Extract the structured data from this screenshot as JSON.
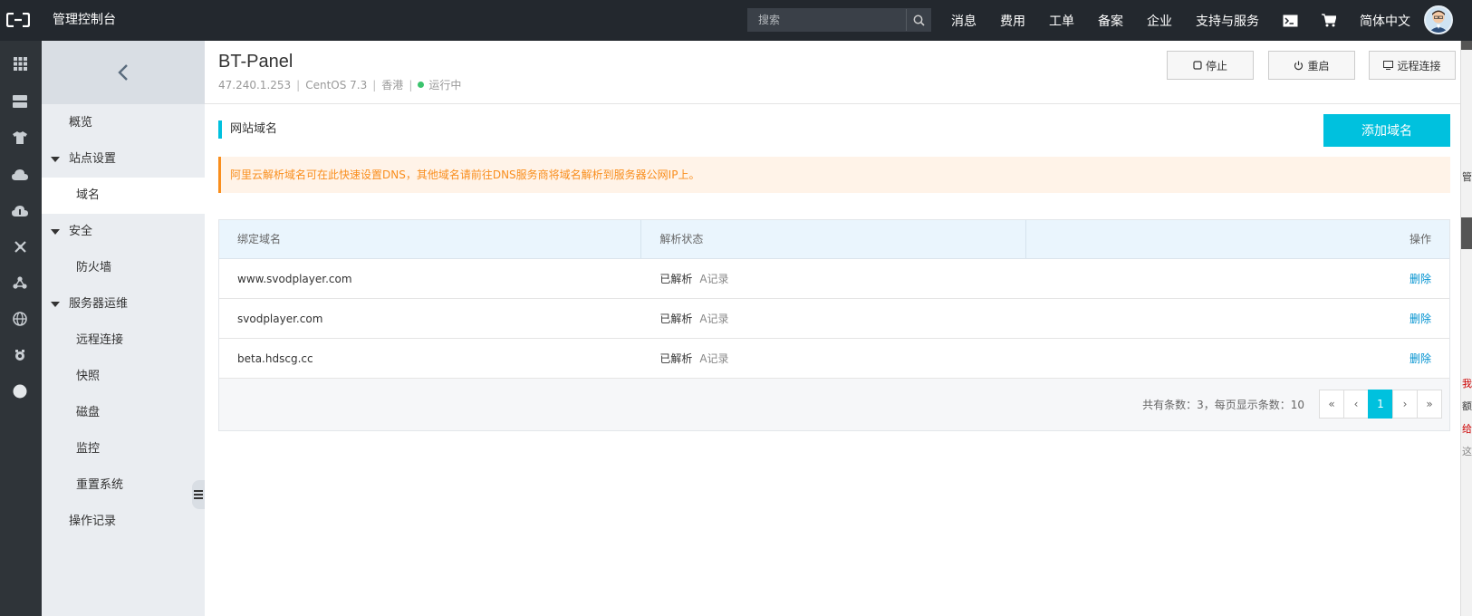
{
  "topbar": {
    "title": "管理控制台",
    "search_placeholder": "搜索",
    "nav": [
      "消息",
      "费用",
      "工单",
      "备案",
      "企业",
      "支持与服务"
    ],
    "language": "简体中文",
    "icons": [
      "terminal-icon",
      "cart-icon"
    ]
  },
  "rail": {
    "icons": [
      "grid-icon",
      "server-icon",
      "shirt-icon",
      "cloud-upload-icon",
      "cloud-download-icon",
      "network-icon",
      "nodes-icon",
      "globe-icon",
      "cog-icon",
      "circle-icon"
    ]
  },
  "sidebar": {
    "items": [
      {
        "label": "概览",
        "level": 1
      },
      {
        "label": "站点设置",
        "level": 1,
        "expanded": true
      },
      {
        "label": "域名",
        "level": 2,
        "active": true
      },
      {
        "label": "安全",
        "level": 1,
        "expanded": true
      },
      {
        "label": "防火墙",
        "level": 2
      },
      {
        "label": "服务器运维",
        "level": 1,
        "expanded": true
      },
      {
        "label": "远程连接",
        "level": 2
      },
      {
        "label": "快照",
        "level": 2
      },
      {
        "label": "磁盘",
        "level": 2
      },
      {
        "label": "监控",
        "level": 2
      },
      {
        "label": "重置系统",
        "level": 2
      },
      {
        "label": "操作记录",
        "level": 1
      }
    ]
  },
  "header": {
    "title": "BT-Panel",
    "ip": "47.240.1.253",
    "os": "CentOS 7.3",
    "region": "香港",
    "status": "运行中",
    "buttons": {
      "stop": "停止",
      "restart": "重启",
      "remote": "远程连接"
    }
  },
  "section": {
    "title": "网站域名",
    "add_button": "添加域名",
    "notice": "阿里云解析域名可在此快速设置DNS，其他域名请前往DNS服务商将域名解析到服务器公网IP上。"
  },
  "table": {
    "columns": [
      "绑定域名",
      "解析状态",
      "操作"
    ],
    "rows": [
      {
        "domain": "www.svodplayer.com",
        "status": "已解析",
        "record": "A记录",
        "action": "删除"
      },
      {
        "domain": "svodplayer.com",
        "status": "已解析",
        "record": "A记录",
        "action": "删除"
      },
      {
        "domain": "beta.hdscg.cc",
        "status": "已解析",
        "record": "A记录",
        "action": "删除"
      }
    ],
    "pagination": {
      "info": "共有条数：3，每页显示条数：10",
      "first": "«",
      "prev": "‹",
      "current": "1",
      "next": "›",
      "last": "»"
    }
  },
  "edge_glimpse": [
    "管",
    "我",
    "额",
    "给",
    "这"
  ],
  "colors": {
    "accent": "#00c1de",
    "topbar": "#23282e",
    "notice": "#f98e1d",
    "link": "#0092d0",
    "running": "#3bc36d"
  }
}
